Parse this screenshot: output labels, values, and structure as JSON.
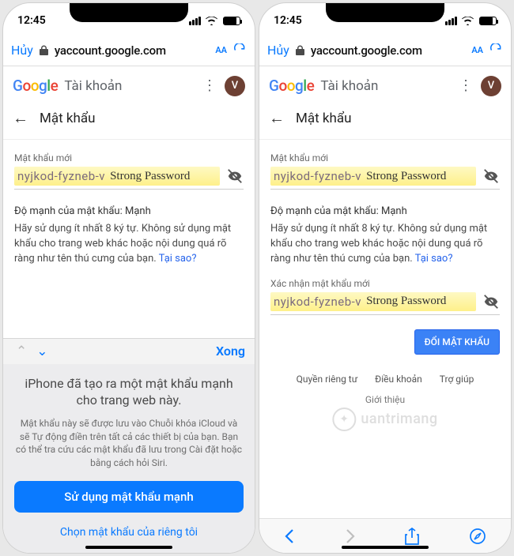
{
  "status": {
    "time": "12:45"
  },
  "browser": {
    "cancel": "Hủy",
    "url": "yaccount.google.com",
    "aa": "AA"
  },
  "app": {
    "account_word": "Tài khoản",
    "avatar_initial": "V",
    "page_title": "Mật khẩu"
  },
  "fields": {
    "new_password_label": "Mật khẩu mới",
    "confirm_password_label": "Xác nhận mật khẩu mới",
    "generated_value": "nyjkod-fyzneb-v",
    "strong_label": "Strong Password"
  },
  "strength": {
    "line": "Độ mạnh của mật khẩu: Mạnh",
    "hint_part": "Hãy sử dụng ít nhất 8 ký tự. Không sử dụng mật khẩu cho trang web khác hoặc nội dung quá rõ ràng như tên thú cưng của bạn. ",
    "why": "Tại sao?"
  },
  "keyboard": {
    "done": "Xong"
  },
  "sheet": {
    "title": "iPhone đã tạo ra một mật khẩu mạnh cho trang web này.",
    "body": "Mật khẩu này sẽ được lưu vào Chuỗi khóa iCloud và sẽ Tự động điền trên tất cả các thiết bị của bạn. Bạn có thể tra cứu các mật khẩu đã lưu trong Cài đặt hoặc bằng cách hỏi Siri.",
    "primary": "Sử dụng mật khẩu mạnh",
    "secondary": "Chọn mật khẩu của riêng tôi"
  },
  "actions": {
    "change_password": "ĐỔI MẬT KHẨU"
  },
  "footer": {
    "privacy": "Quyền riêng tư",
    "terms": "Điều khoản",
    "help": "Trợ giúp",
    "intro": "Giới thiệu"
  },
  "watermark": "uantrimang"
}
